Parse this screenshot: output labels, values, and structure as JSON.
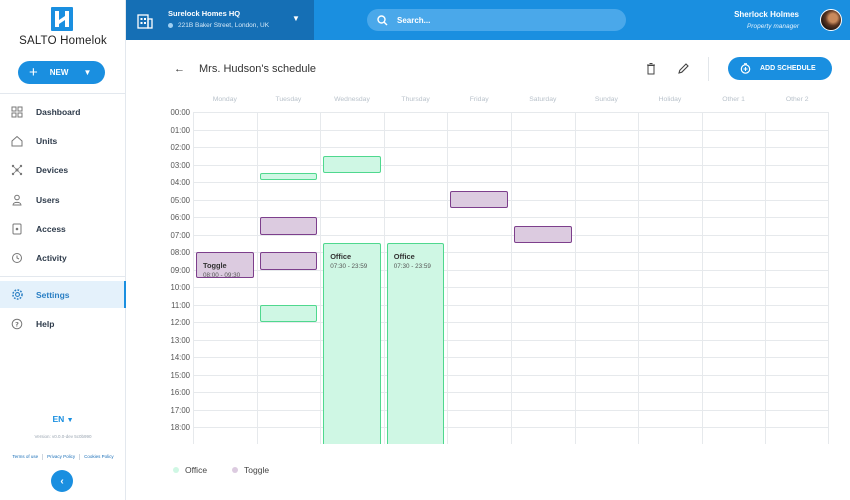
{
  "brand": "SALTO Homelok",
  "new_button": "NEW",
  "nav": [
    {
      "label": "Dashboard",
      "icon": "dashboard-icon"
    },
    {
      "label": "Units",
      "icon": "home-icon"
    },
    {
      "label": "Devices",
      "icon": "devices-icon"
    },
    {
      "label": "Users",
      "icon": "user-icon"
    },
    {
      "label": "Access",
      "icon": "access-icon"
    },
    {
      "label": "Activity",
      "icon": "history-icon"
    },
    {
      "label": "Settings",
      "icon": "gear-icon",
      "active": true
    },
    {
      "label": "Help",
      "icon": "help-icon"
    }
  ],
  "language": "EN",
  "version": "Version: v0.0.0-dev 5c0b990",
  "footer_links": [
    "Terms of use",
    "Privacy Policy",
    "Cookies Policy"
  ],
  "site": {
    "name": "Surelock Homes HQ",
    "address": "221B Baker Street, London, UK"
  },
  "search": {
    "placeholder": "Search..."
  },
  "user": {
    "name": "Sherlock Holmes",
    "role": "Property manager"
  },
  "page_title": "Mrs. Hudson's schedule",
  "add_schedule_label": "ADD SCHEDULE",
  "days": [
    "Monday",
    "Tuesday",
    "Wednesday",
    "Thursday",
    "Friday",
    "Saturday",
    "Sunday",
    "Holiday",
    "Other 1",
    "Other 2"
  ],
  "hours": [
    "00:00",
    "01:00",
    "02:00",
    "03:00",
    "04:00",
    "05:00",
    "06:00",
    "07:00",
    "08:00",
    "09:00",
    "10:00",
    "11:00",
    "12:00",
    "13:00",
    "14:00",
    "15:00",
    "16:00",
    "17:00",
    "18:00"
  ],
  "events": [
    {
      "day": 0,
      "start": 8.0,
      "end": 9.5,
      "type": "toggle",
      "title": "Toggle",
      "time": "08:00 - 09:30"
    },
    {
      "day": 1,
      "start": 3.5,
      "end": 3.9,
      "type": "office"
    },
    {
      "day": 1,
      "start": 6.0,
      "end": 7.0,
      "type": "toggle"
    },
    {
      "day": 1,
      "start": 8.0,
      "end": 9.0,
      "type": "toggle"
    },
    {
      "day": 1,
      "start": 11.0,
      "end": 12.0,
      "type": "office"
    },
    {
      "day": 2,
      "start": 2.5,
      "end": 3.5,
      "type": "office"
    },
    {
      "day": 2,
      "start": 7.5,
      "end": 24.0,
      "type": "office",
      "title": "Office",
      "time": "07:30 - 23:59"
    },
    {
      "day": 3,
      "start": 7.5,
      "end": 24.0,
      "type": "office",
      "title": "Office",
      "time": "07:30 - 23:59"
    },
    {
      "day": 4,
      "start": 4.5,
      "end": 5.5,
      "type": "toggle"
    },
    {
      "day": 5,
      "start": 6.5,
      "end": 7.5,
      "type": "toggle"
    }
  ],
  "legend": [
    {
      "label": "Office",
      "color": "#cff7e4"
    },
    {
      "label": "Toggle",
      "color": "#dccbe0"
    }
  ]
}
